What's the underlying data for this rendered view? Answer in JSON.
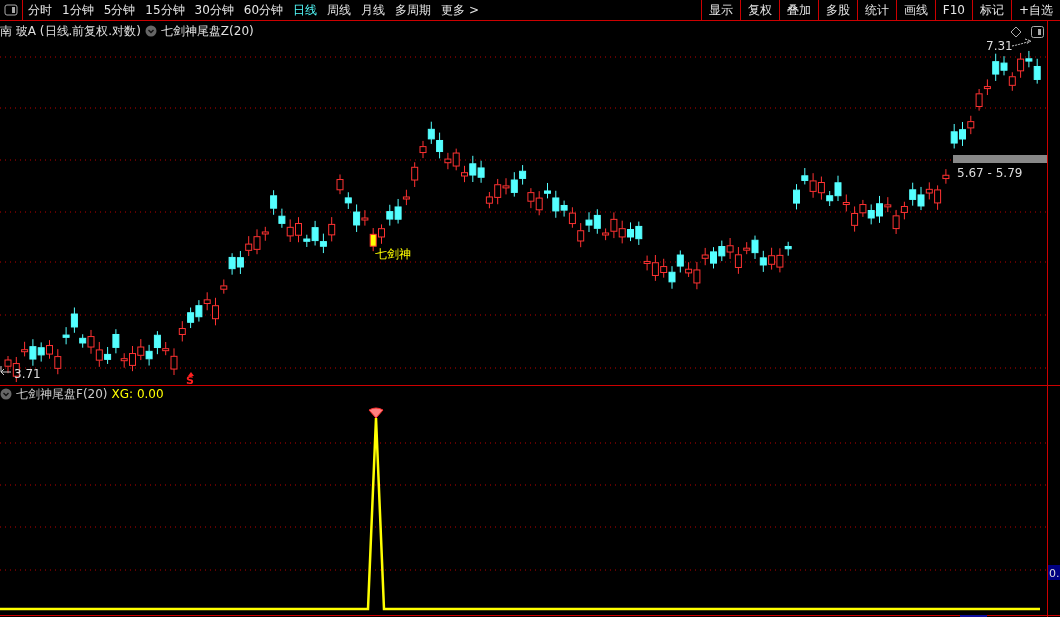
{
  "toolbar": {
    "periods": [
      {
        "label": "分时",
        "selected": false
      },
      {
        "label": "1分钟",
        "selected": false
      },
      {
        "label": "5分钟",
        "selected": false
      },
      {
        "label": "15分钟",
        "selected": false
      },
      {
        "label": "30分钟",
        "selected": false
      },
      {
        "label": "60分钟",
        "selected": false
      },
      {
        "label": "日线",
        "selected": true
      },
      {
        "label": "周线",
        "selected": false
      },
      {
        "label": "月线",
        "selected": false
      },
      {
        "label": "多周期",
        "selected": false
      },
      {
        "label": "更多 >",
        "selected": false
      }
    ],
    "buttons": [
      "显示",
      "复权",
      "叠加",
      "多股",
      "统计",
      "画线",
      "F10",
      "标记",
      "+自选"
    ]
  },
  "main_panel": {
    "stock_title": "南 玻A (日线.前复权.对数)",
    "indicator": "七剑神尾盘Z(20)",
    "high_label": "7.31",
    "low_label": "3.71",
    "range_label": "5.67 - 5.79",
    "signal_label": "七剑神",
    "marker": "S"
  },
  "sub_panel": {
    "indicator": "七剑神尾盘F(20)",
    "value_label": "XG: 0.00",
    "axis_label": "0."
  }
}
